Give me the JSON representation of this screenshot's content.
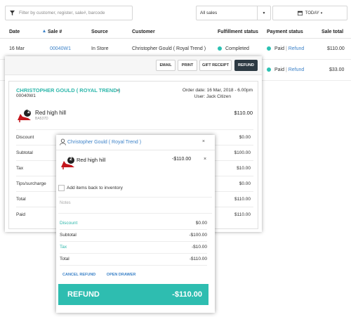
{
  "filters": {
    "search_placeholder": "Filter by customer, register, sale#, barcode",
    "sales_select": "All sales",
    "date_button": "TODAY"
  },
  "table": {
    "headers": [
      "Date",
      "Sale #",
      "Source",
      "Customer",
      "Fulfillment status",
      "Payment status",
      "Sale total"
    ],
    "rows": [
      {
        "date": "16 Mar",
        "sale": "00040W1",
        "source": "In Store",
        "customer": "Christopher Gould ( Royal Trend )",
        "fulfillment": "Completed",
        "paid": "Paid",
        "sep": "|",
        "refund": "Refund",
        "total": "$110.00"
      },
      {
        "paid": "Paid",
        "sep": "|",
        "refund": "Refund",
        "total": "$33.00"
      }
    ]
  },
  "detail": {
    "buttons": {
      "email": "EMAIL",
      "print": "PRINT",
      "gift": "GIFT RECEIPT",
      "refund": "REFUND"
    },
    "customer": "CHRISTOPHER GOULD ( ROYAL TREND )",
    "close": "×",
    "order_id": "00040W1",
    "order_date": "Order date: 16 Mar, 2018 - 6.00pm",
    "user": "User: Jack Citizen",
    "item": {
      "qty": "2",
      "name": "Red high hill",
      "sku": "BA537D",
      "price": "$110.00"
    },
    "summary": [
      {
        "label": "Discount",
        "value": "$0.00"
      },
      {
        "label": "Subtotal",
        "value": "$100.00"
      },
      {
        "label": "Tax",
        "value": "$10.00"
      },
      {
        "label": "Tips/surcharge",
        "value": "$0.00"
      },
      {
        "label": "Total",
        "value": "$110.00"
      },
      {
        "label": "Paid",
        "value": "$110.00"
      }
    ]
  },
  "refund_modal": {
    "customer": "Christopher Gould ( Royal Trend )",
    "close": "×",
    "item": {
      "qty": "2",
      "name": "Red high hill",
      "price": "-$110.00",
      "remove": "×"
    },
    "checkbox_label": "Add items back to inventory",
    "notes_placeholder": "Notes",
    "rows": [
      {
        "label": "Discount",
        "value": "$0.00"
      },
      {
        "label": "Subtotal",
        "value": "-$100.00"
      },
      {
        "label": "Tax",
        "value": "-$10.00"
      },
      {
        "label": "Total",
        "value": "-$110.00"
      }
    ],
    "cancel_refund": "CANCEL REFUND",
    "open_drawer": "OPEN DRAWER",
    "refund_label": "REFUND",
    "refund_amount": "-$110.00"
  },
  "colors": {
    "accent_teal": "#2ebdb0",
    "link_blue": "#3c82c8",
    "dark_button": "#2d3a43",
    "shoe_red": "#c4161c"
  },
  "icons": [
    "filter-icon",
    "chevron-down-icon",
    "calendar-icon",
    "sort-icon",
    "status-dot",
    "close-icon",
    "user-icon",
    "shoe-icon"
  ]
}
